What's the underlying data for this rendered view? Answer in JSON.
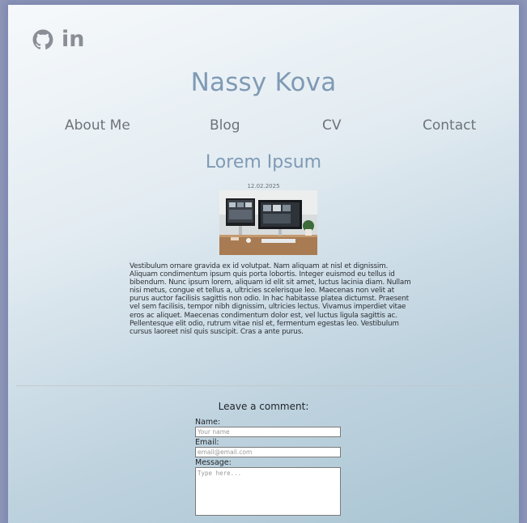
{
  "social": {
    "icons": [
      "github-icon",
      "linkedin-icon"
    ],
    "linkedin_text": "in"
  },
  "site": {
    "title": "Nassy Kova"
  },
  "nav": {
    "items": [
      {
        "label": "About Me"
      },
      {
        "label": "Blog"
      },
      {
        "label": "CV"
      },
      {
        "label": "Contact"
      }
    ]
  },
  "post": {
    "title": "Lorem Ipsum",
    "date": "12.02.2025",
    "image_icon": "desk-computers-photo",
    "body": "Vestibulum ornare gravida ex id volutpat. Nam aliquam at nisl et dignissim. Aliquam condimentum ipsum quis porta lobortis. Integer euismod eu tellus id bibendum. Nunc ipsum lorem, aliquam id elit sit amet, luctus lacinia diam. Nullam nisi metus, congue et tellus a, ultricies scelerisque leo. Maecenas non velit at purus auctor facilisis sagittis non odio. In hac habitasse platea dictumst. Praesent vel sem facilisis, tempor nibh dignissim, ultricies lectus. Vivamus imperdiet vitae eros ac aliquet. Maecenas condimentum dolor est, vel luctus ligula sagittis ac. Pellentesque elit odio, rutrum vitae nisl et, fermentum egestas leo. Vestibulum cursus laoreet nisl quis suscipit. Cras a ante purus."
  },
  "comment": {
    "title": "Leave a comment:",
    "name_label": "Name:",
    "name_placeholder": "Your name",
    "email_label": "Email:",
    "email_placeholder": "email@email.com",
    "message_label": "Message:",
    "message_placeholder": "Type here..."
  },
  "colors": {
    "accent": "#7f9ab5",
    "icon": "#8a8f96",
    "nav_text": "#6e7378"
  }
}
